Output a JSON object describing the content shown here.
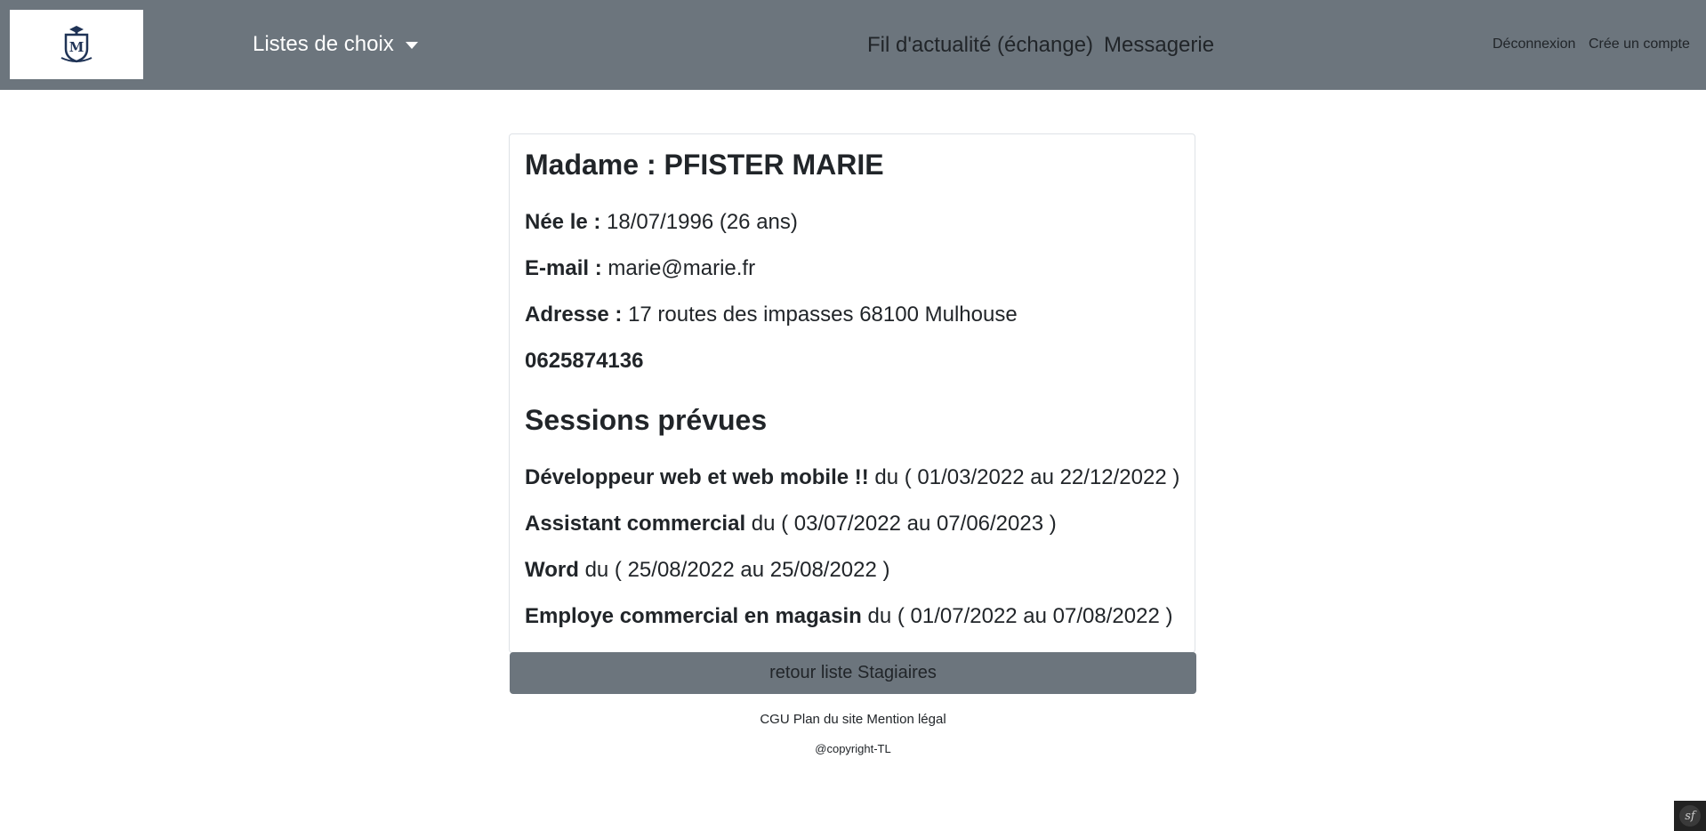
{
  "navbar": {
    "brand_logo_alt": "logo",
    "dropdown_label": "Listes de choix",
    "feed_link": "Fil d'actualité (échange)",
    "messages_link": "Messagerie",
    "logout_link": "Déconnexion",
    "signup_link": "Crée un compte"
  },
  "profile": {
    "title": "Madame : PFISTER MARIE",
    "birth_label": "Née le :",
    "birth_value": "18/07/1996 (26 ans)",
    "email_label": "E-mail :",
    "email_value": "marie@marie.fr",
    "address_label": "Adresse :",
    "address_value": "17 routes des impasses 68100 Mulhouse",
    "phone": "0625874136"
  },
  "sessions": {
    "heading": "Sessions prévues",
    "items": [
      {
        "name": "Développeur web et web mobile !!",
        "dates": "du ( 01/03/2022 au 22/12/2022 )"
      },
      {
        "name": "Assistant commercial",
        "dates": "du ( 03/07/2022 au 07/06/2023 )"
      },
      {
        "name": "Word",
        "dates": "du ( 25/08/2022 au 25/08/2022 )"
      },
      {
        "name": "Employe commercial en magasin",
        "dates": "du ( 01/07/2022 au 07/08/2022 )"
      }
    ]
  },
  "back_button_label": "retour liste Stagiaires",
  "footer": {
    "cgu": "CGU",
    "sitemap": "Plan du site",
    "legal": "Mention légal",
    "copyright": "@copyright-TL"
  },
  "symfony_badge": "sf",
  "colors": {
    "navbar_bg": "#6c757d",
    "text": "#212529",
    "logo_navy": "#1f3356"
  },
  "icons": {
    "logo": "school-crest-icon",
    "dropdown": "caret-down-icon",
    "toolbar": "symfony-icon"
  }
}
